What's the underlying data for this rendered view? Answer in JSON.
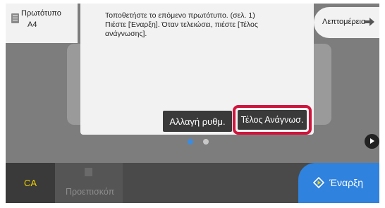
{
  "header": {
    "original_label": "Πρωτότυπο",
    "original_size": "A4",
    "original_icon": "document-icon",
    "details_label": "Λεπτομέρεια",
    "details_icon": "arrow-right-icon"
  },
  "dialog": {
    "message": "Τοποθετήστε το επόμενο πρωτότυπο. (σελ. 1) Πιέστε [Έναρξη]. Όταν τελειώσει, πιέστε [Τέλος ανάγνωσης].",
    "change_settings_label": "Αλλαγή ρυθμ.",
    "end_reading_label": "Τέλος Ανάγνωσ.",
    "highlight_color": "#d0143c"
  },
  "pager": {
    "pages": 2,
    "active_page": 1,
    "next_icon": "play-right-icon"
  },
  "bottom_bar": {
    "ca_label": "CA",
    "preview_label": "Προεπισκόπ",
    "preview_icon": "preview-icon",
    "start_label": "Έναρξη",
    "start_icon": "diamond-start-icon",
    "start_color": "#2f82dd",
    "ca_color": "#f0d000"
  }
}
